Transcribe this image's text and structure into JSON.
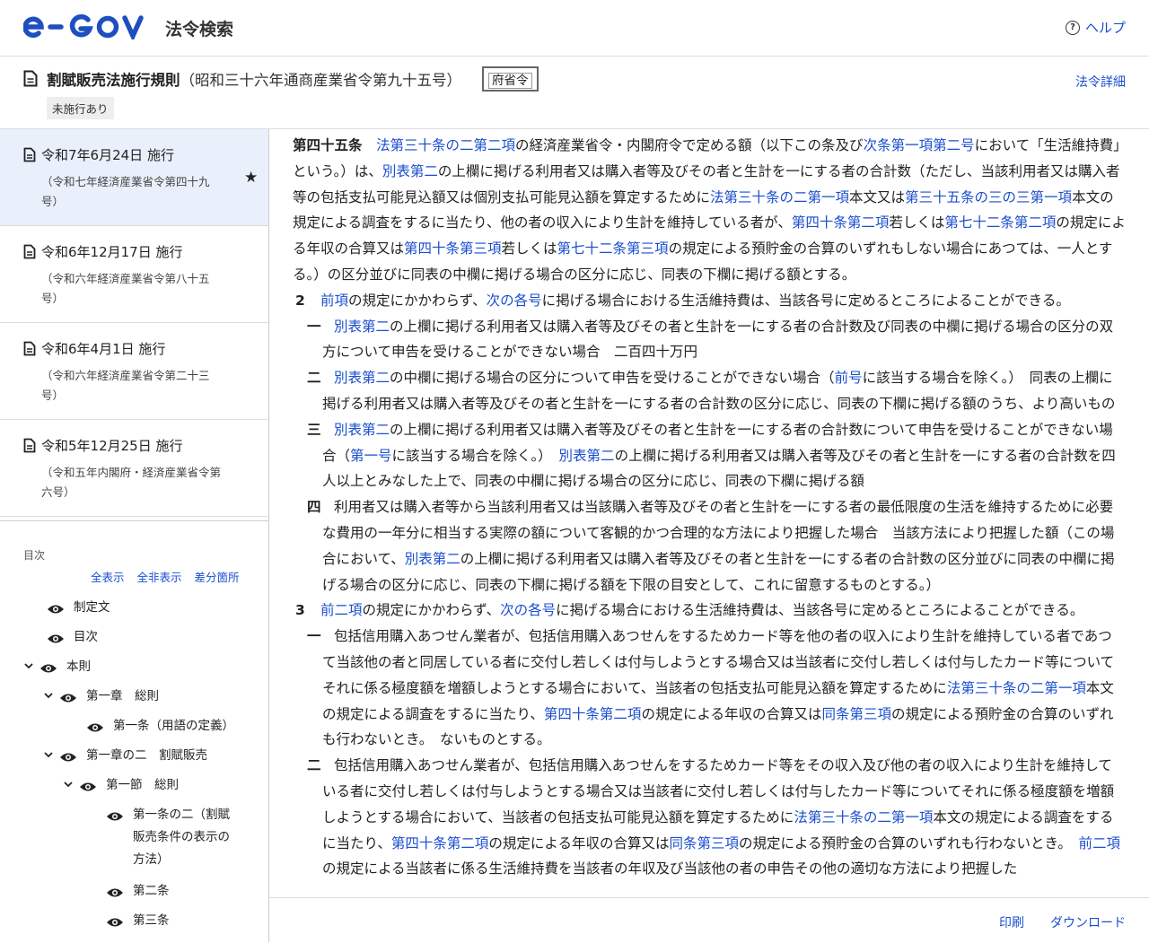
{
  "header": {
    "logo": "e-GOV",
    "site_title": "法令検索",
    "help": "ヘルプ"
  },
  "law": {
    "title": "割賦販売法施行規則",
    "number": "（昭和三十六年通商産業省令第九十五号）",
    "kind": "府省令",
    "badge": "未施行あり",
    "detail_link": "法令詳細"
  },
  "revisions": [
    {
      "date": "令和7年6月24日 施行",
      "note": "（令和七年経済産業省令第四十九号）",
      "active": true
    },
    {
      "date": "令和6年12月17日 施行",
      "note": "（令和六年経済産業省令第八十五号）"
    },
    {
      "date": "令和6年4月1日 施行",
      "note": "（令和六年経済産業省令第二十三号）"
    },
    {
      "date": "令和5年12月25日 施行",
      "note": "（令和五年内閣府・経済産業省令第六号）"
    }
  ],
  "toc": {
    "label": "目次",
    "show_all": "全表示",
    "hide_all": "全非表示",
    "diff": "差分箇所",
    "items": [
      "制定文",
      "目次",
      "本則",
      "第一章　総則",
      "第一条（用語の定義）",
      "第一章の二　割賦販売",
      "第一節　総則",
      "第一条の二（割賦販売条件の表示の方法）",
      "第二条",
      "第三条"
    ]
  },
  "article": {
    "heading": "第四十五条",
    "p1": [
      {
        "l": "法第三十条の二第二項"
      },
      {
        "t": "の経済産業省令・内閣府令で定める額（以下この条及び"
      },
      {
        "l": "次条第一項第二号"
      },
      {
        "t": "において「生活維持費」という。）は、"
      },
      {
        "l": "別表第二"
      },
      {
        "t": "の上欄に掲げる利用者又は購入者等及びその者と生計を一にする者の合計数（ただし、当該利用者又は購入者等の包括支払可能見込額又は個別支払可能見込額を算定するために"
      },
      {
        "l": "法第三十条の二第一項"
      },
      {
        "t": "本文又は"
      },
      {
        "l": "第三十五条の三の三第一項"
      },
      {
        "t": "本文の規定による調査をするに当たり、他の者の収入により生計を維持している者が、"
      },
      {
        "l": "第四十条第二項"
      },
      {
        "t": "若しくは"
      },
      {
        "l": "第七十二条第二項"
      },
      {
        "t": "の規定による年収の合算又は"
      },
      {
        "l": "第四十条第三項"
      },
      {
        "t": "若しくは"
      },
      {
        "l": "第七十二条第三項"
      },
      {
        "t": "の規定による預貯金の合算のいずれもしない場合にあつては、一人とする。）の区分並びに同表の中欄に掲げる場合の区分に応じ、同表の下欄に掲げる額とする。"
      }
    ],
    "p2_num": "2",
    "p2": [
      {
        "l": "前項"
      },
      {
        "t": "の規定にかかわらず、"
      },
      {
        "l": "次の各号"
      },
      {
        "t": "に掲げる場合における生活維持費は、当該各号に定めるところによることができる。"
      }
    ],
    "p2_items": [
      {
        "num": "一",
        "parts": [
          {
            "l": "別表第二"
          },
          {
            "t": "の上欄に掲げる利用者又は購入者等及びその者と生計を一にする者の合計数及び同表の中欄に掲げる場合の区分の双方について申告を受けることができない場合　二百四十万円"
          }
        ]
      },
      {
        "num": "二",
        "parts": [
          {
            "l": "別表第二"
          },
          {
            "t": "の中欄に掲げる場合の区分について申告を受けることができない場合（"
          },
          {
            "l": "前号"
          },
          {
            "t": "に該当する場合を除く。）　同表の上欄に掲げる利用者又は購入者等及びその者と生計を一にする者の合計数の区分に応じ、同表の下欄に掲げる額のうち、より高いもの"
          }
        ]
      },
      {
        "num": "三",
        "parts": [
          {
            "l": "別表第二"
          },
          {
            "t": "の上欄に掲げる利用者又は購入者等及びその者と生計を一にする者の合計数について申告を受けることができない場合（"
          },
          {
            "l": "第一号"
          },
          {
            "t": "に該当する場合を除く。）　"
          },
          {
            "l": "別表第二"
          },
          {
            "t": "の上欄に掲げる利用者又は購入者等及びその者と生計を一にする者の合計数を四人以上とみなした上で、同表の中欄に掲げる場合の区分に応じ、同表の下欄に掲げる額"
          }
        ]
      },
      {
        "num": "四",
        "parts": [
          {
            "t": "利用者又は購入者等から当該利用者又は当該購入者等及びその者と生計を一にする者の最低限度の生活を維持するために必要な費用の一年分に相当する実際の額について客観的かつ合理的な方法により把握した場合　当該方法により把握した額（この場合において、"
          },
          {
            "l": "別表第二"
          },
          {
            "t": "の上欄に掲げる利用者又は購入者等及びその者と生計を一にする者の合計数の区分並びに同表の中欄に掲げる場合の区分に応じ、同表の下欄に掲げる額を下限の目安として、これに留意するものとする。）"
          }
        ]
      }
    ],
    "p3_num": "3",
    "p3": [
      {
        "l": "前二項"
      },
      {
        "t": "の規定にかかわらず、"
      },
      {
        "l": "次の各号"
      },
      {
        "t": "に掲げる場合における生活維持費は、当該各号に定めるところによることができる。"
      }
    ],
    "p3_items": [
      {
        "num": "一",
        "parts": [
          {
            "t": "包括信用購入あつせん業者が、包括信用購入あつせんをするためカード等を他の者の収入により生計を維持している者であつて当該他の者と同居している者に交付し若しくは付与しようとする場合又は当該者に交付し若しくは付与したカード等についてそれに係る極度額を増額しようとする場合において、当該者の包括支払可能見込額を算定するために"
          },
          {
            "l": "法第三十条の二第一項"
          },
          {
            "t": "本文の規定による調査をするに当たり、"
          },
          {
            "l": "第四十条第二項"
          },
          {
            "t": "の規定による年収の合算又は"
          },
          {
            "l": "同条第三項"
          },
          {
            "t": "の規定による預貯金の合算のいずれも行わないとき。　ないものとする。"
          }
        ]
      },
      {
        "num": "二",
        "parts": [
          {
            "t": "包括信用購入あつせん業者が、包括信用購入あつせんをするためカード等をその収入及び他の者の収入により生計を維持している者に交付し若しくは付与しようとする場合又は当該者に交付し若しくは付与したカード等についてそれに係る極度額を増額しようとする場合において、当該者の包括支払可能見込額を算定するために"
          },
          {
            "l": "法第三十条の二第一項"
          },
          {
            "t": "本文の規定による調査をするに当たり、"
          },
          {
            "l": "第四十条第二項"
          },
          {
            "t": "の規定による年収の合算又は"
          },
          {
            "l": "同条第三項"
          },
          {
            "t": "の規定による預貯金の合算のいずれも行わないとき。　"
          },
          {
            "l": "前二項"
          },
          {
            "t": "の規定による当該者に係る生活維持費を当該者の年収及び当該他の者の申告その他の適切な方法により把握した"
          }
        ]
      }
    ]
  },
  "footer": {
    "print": "印刷",
    "download": "ダウンロード"
  },
  "colors": {
    "link": "#1a4ecf",
    "logo_blue": "#1f4fbf",
    "active_bg": "#e9f0fb"
  }
}
